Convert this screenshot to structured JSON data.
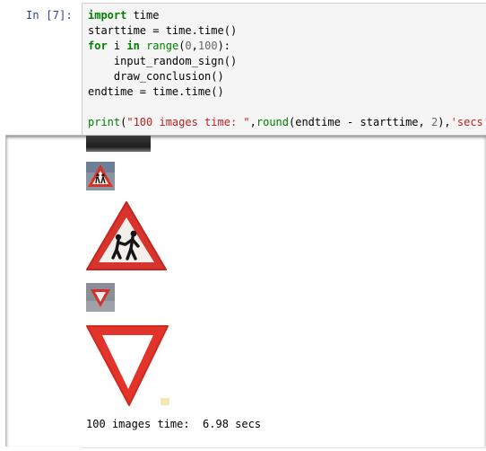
{
  "cell": {
    "prompt": "In  [7]:",
    "code_lines": [
      [
        {
          "t": "import",
          "c": "kw"
        },
        {
          "t": " time",
          "c": ""
        }
      ],
      [
        {
          "t": "starttime = time.time()",
          "c": ""
        }
      ],
      [
        {
          "t": "for",
          "c": "kw"
        },
        {
          "t": " i ",
          "c": ""
        },
        {
          "t": "in",
          "c": "kw"
        },
        {
          "t": " ",
          "c": ""
        },
        {
          "t": "range",
          "c": "bi"
        },
        {
          "t": "(",
          "c": ""
        },
        {
          "t": "0",
          "c": "num"
        },
        {
          "t": ",",
          "c": ""
        },
        {
          "t": "100",
          "c": "num"
        },
        {
          "t": "):",
          "c": ""
        }
      ],
      [
        {
          "t": "    input_random_sign()",
          "c": ""
        }
      ],
      [
        {
          "t": "    draw_conclusion()",
          "c": ""
        }
      ],
      [
        {
          "t": "endtime = time.time()",
          "c": ""
        }
      ],
      [
        {
          "t": "",
          "c": ""
        }
      ],
      [
        {
          "t": "print",
          "c": "bi"
        },
        {
          "t": "(",
          "c": ""
        },
        {
          "t": "\"100 images time: \"",
          "c": "str"
        },
        {
          "t": ",",
          "c": ""
        },
        {
          "t": "round",
          "c": "bi"
        },
        {
          "t": "(endtime ",
          "c": ""
        },
        {
          "t": "-",
          "c": ""
        },
        {
          "t": " starttime, ",
          "c": ""
        },
        {
          "t": "2",
          "c": "num"
        },
        {
          "t": "),",
          "c": ""
        },
        {
          "t": "'secs'",
          "c": "str"
        },
        {
          "t": ")",
          "c": ""
        }
      ]
    ]
  },
  "output": {
    "images": [
      {
        "name": "children-crossing-sign-small",
        "kind": "children"
      },
      {
        "name": "children-crossing-sign-large",
        "kind": "children"
      },
      {
        "name": "yield-sign-small",
        "kind": "yield"
      },
      {
        "name": "yield-sign-large",
        "kind": "yield"
      }
    ],
    "text": "100 images time:  6.98 secs"
  },
  "colors": {
    "sign_red": "#e1251e",
    "prompt_blue": "#303f9f",
    "keyword_green": "#008000",
    "string_red": "#ba2121"
  }
}
